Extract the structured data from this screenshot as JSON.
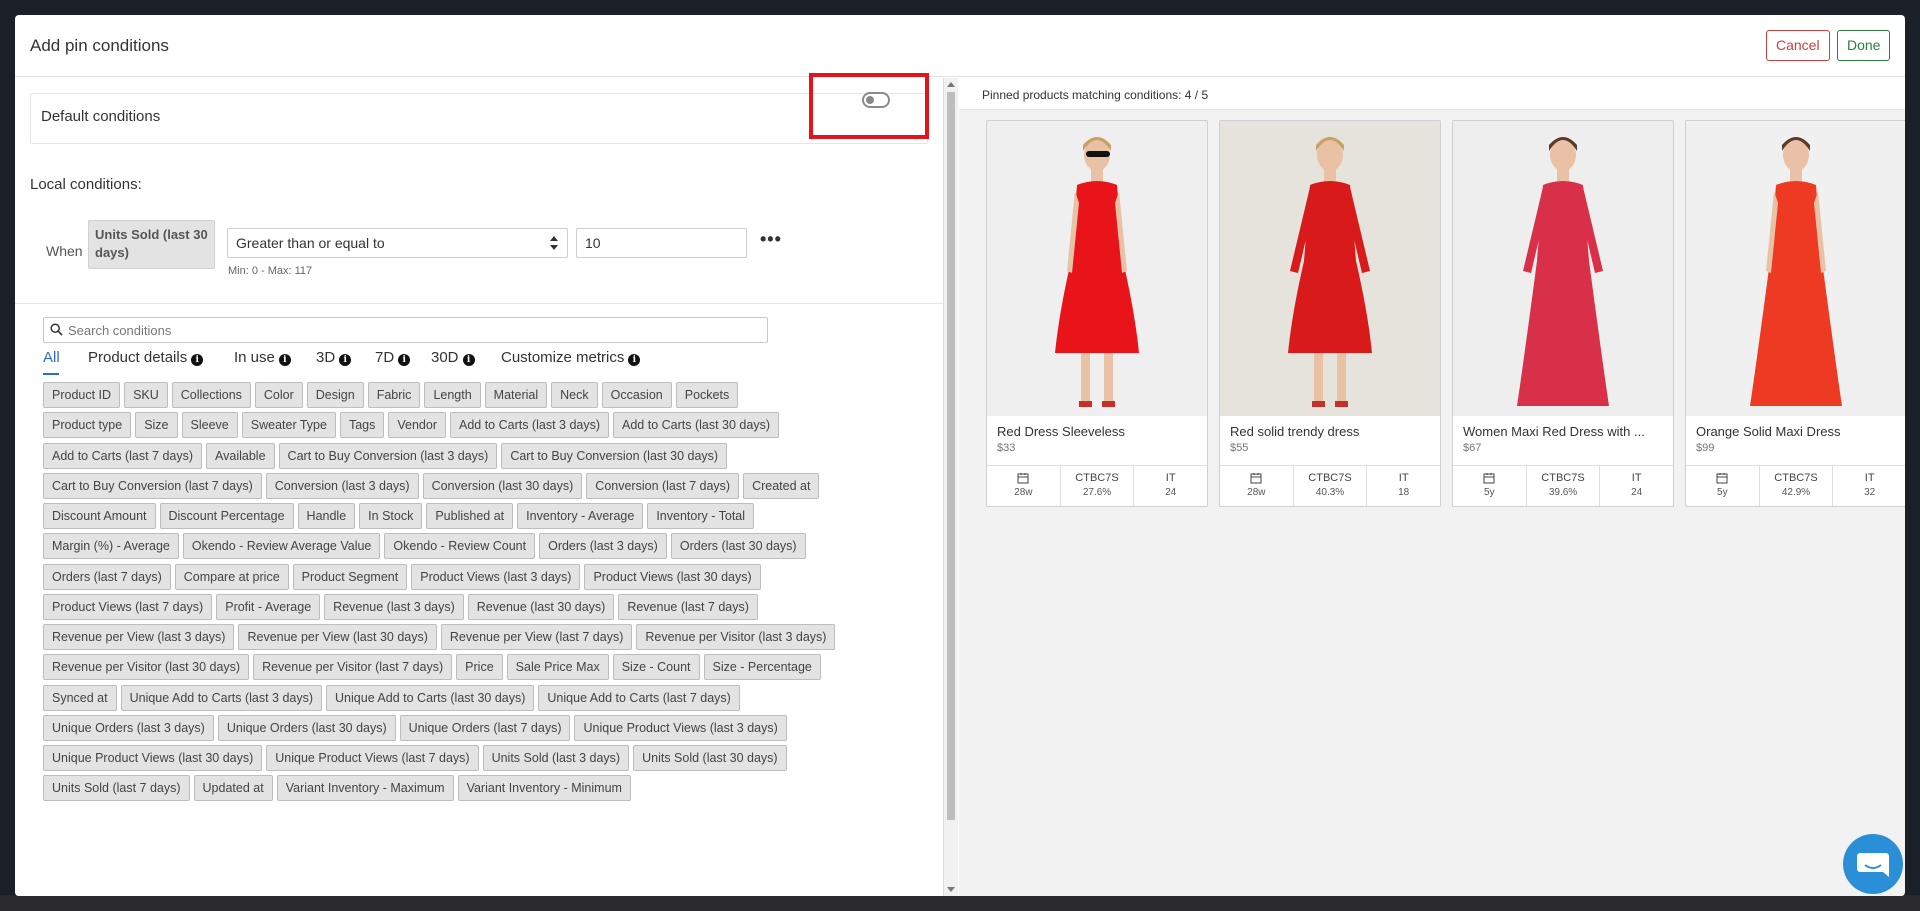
{
  "modal": {
    "title": "Add pin conditions",
    "cancel_label": "Cancel",
    "done_label": "Done"
  },
  "default_conditions": {
    "label": "Default conditions",
    "enabled": false
  },
  "local": {
    "label": "Local conditions:",
    "when_label": "When",
    "metric": "Units Sold (last 30 days)",
    "operator": "Greater than or equal to",
    "value": "10",
    "range_hint": "Min: 0 - Max: 117"
  },
  "search": {
    "placeholder": "Search conditions"
  },
  "tabs": [
    {
      "label": "All",
      "info": false
    },
    {
      "label": "Product details",
      "info": true
    },
    {
      "label": "In use",
      "info": true
    },
    {
      "label": "3D",
      "info": true
    },
    {
      "label": "7D",
      "info": true
    },
    {
      "label": "30D",
      "info": true
    },
    {
      "label": "Customize metrics",
      "info": true
    }
  ],
  "condition_rows": [
    [
      "Product ID",
      "SKU",
      "Collections",
      "Color",
      "Design",
      "Fabric",
      "Length",
      "Material",
      "Neck",
      "Occasion",
      "Pockets"
    ],
    [
      "Product type",
      "Size",
      "Sleeve",
      "Sweater Type",
      "Tags",
      "Vendor",
      "Add to Carts (last 3 days)",
      "Add to Carts (last 30 days)"
    ],
    [
      "Add to Carts (last 7 days)",
      "Available",
      "Cart to Buy Conversion (last 3 days)",
      "Cart to Buy Conversion (last 30 days)"
    ],
    [
      "Cart to Buy Conversion (last 7 days)",
      "Conversion (last 3 days)",
      "Conversion (last 30 days)",
      "Conversion (last 7 days)",
      "Created at"
    ],
    [
      "Discount Amount",
      "Discount Percentage",
      "Handle",
      "In Stock",
      "Published at",
      "Inventory - Average",
      "Inventory - Total"
    ],
    [
      "Margin (%) - Average",
      "Okendo - Review Average Value",
      "Okendo - Review Count",
      "Orders (last 3 days)",
      "Orders (last 30 days)"
    ],
    [
      "Orders (last 7 days)",
      "Compare at price",
      "Product Segment",
      "Product Views (last 3 days)",
      "Product Views (last 30 days)"
    ],
    [
      "Product Views (last 7 days)",
      "Profit - Average",
      "Revenue (last 3 days)",
      "Revenue (last 30 days)",
      "Revenue (last 7 days)"
    ],
    [
      "Revenue per View (last 3 days)",
      "Revenue per View (last 30 days)",
      "Revenue per View (last 7 days)",
      "Revenue per Visitor (last 3 days)"
    ],
    [
      "Revenue per Visitor (last 30 days)",
      "Revenue per Visitor (last 7 days)",
      "Price",
      "Sale Price Max",
      "Size - Count",
      "Size - Percentage"
    ],
    [
      "Synced at",
      "Unique Add to Carts (last 3 days)",
      "Unique Add to Carts (last 30 days)",
      "Unique Add to Carts (last 7 days)"
    ],
    [
      "Unique Orders (last 3 days)",
      "Unique Orders (last 30 days)",
      "Unique Orders (last 7 days)",
      "Unique Product Views (last 3 days)"
    ],
    [
      "Unique Product Views (last 30 days)",
      "Unique Product Views (last 7 days)",
      "Units Sold (last 3 days)",
      "Units Sold (last 30 days)"
    ],
    [
      "Units Sold (last 7 days)",
      "Updated at",
      "Variant Inventory - Maximum",
      "Variant Inventory - Minimum"
    ]
  ],
  "pinned": {
    "text": "Pinned products matching conditions: 4 / 5"
  },
  "products": [
    {
      "name": "Red Dress Sleeveless",
      "price": "$33",
      "age": "28w",
      "ctbc_label": "CTBC7S",
      "ctbc": "27.6%",
      "it_label": "IT",
      "it": "24",
      "dress_color": "#e8141a",
      "bg_color": "#efefef"
    },
    {
      "name": "Red solid trendy dress",
      "price": "$55",
      "age": "28w",
      "ctbc_label": "CTBC7S",
      "ctbc": "40.3%",
      "it_label": "IT",
      "it": "18",
      "dress_color": "#d91a1a",
      "bg_color": "#e6e3dc"
    },
    {
      "name": "Women Maxi Red Dress with ...",
      "price": "$67",
      "age": "5y",
      "ctbc_label": "CTBC7S",
      "ctbc": "39.6%",
      "it_label": "IT",
      "it": "24",
      "dress_color": "#d9304a",
      "bg_color": "#eeeeee"
    },
    {
      "name": "Orange Solid Maxi Dress",
      "price": "$99",
      "age": "5y",
      "ctbc_label": "CTBC7S",
      "ctbc": "42.9%",
      "it_label": "IT",
      "it": "32",
      "dress_color": "#ee3a22",
      "bg_color": "#f0f0f0"
    }
  ],
  "colors": {
    "accent": "#2e6bd9",
    "cancel": "#c9413f",
    "done": "#2f7d3c",
    "highlight": "#e4141d",
    "chat": "#2a8fd6"
  }
}
